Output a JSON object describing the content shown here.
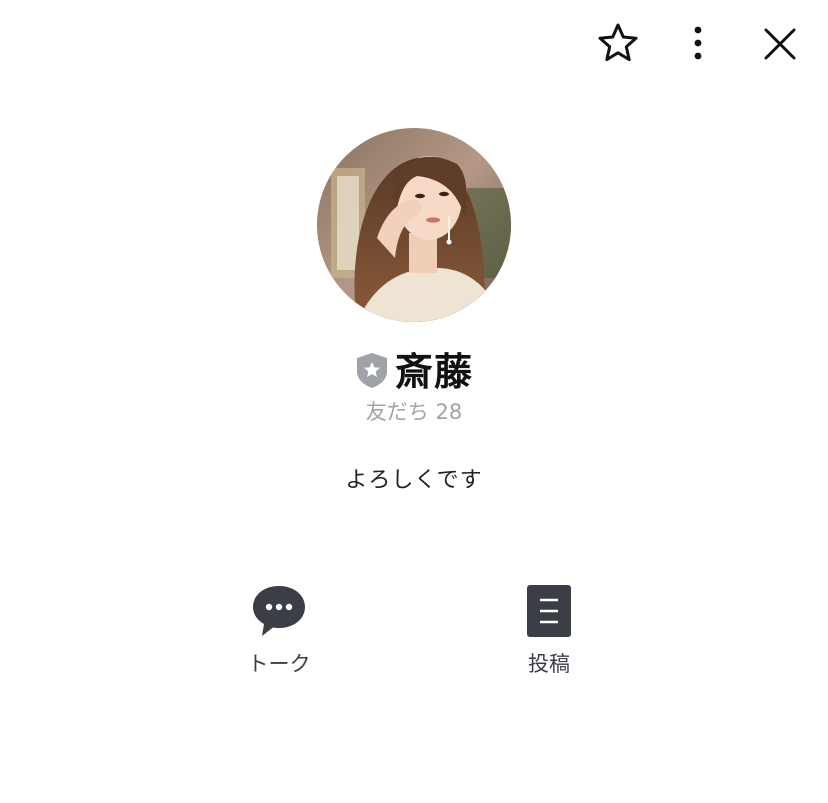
{
  "header": {
    "favorite_icon": "star-outline-icon",
    "more_icon": "vertical-dots-icon",
    "close_icon": "close-x-icon"
  },
  "profile": {
    "avatar_icon": "profile-photo",
    "badge_icon": "shield-star-icon",
    "name": "斎藤",
    "friends_count": "友だち 28",
    "status_message": "よろしくです"
  },
  "actions": [
    {
      "label": "トーク",
      "icon": "chat-bubble-icon"
    },
    {
      "label": "投稿",
      "icon": "post-document-icon"
    }
  ],
  "colors": {
    "background": "#ffffff",
    "text_primary": "#111111",
    "text_secondary": "#a3a3a3",
    "icon_dark": "#3b3f45",
    "badge_gray": "#9fa3a8"
  }
}
